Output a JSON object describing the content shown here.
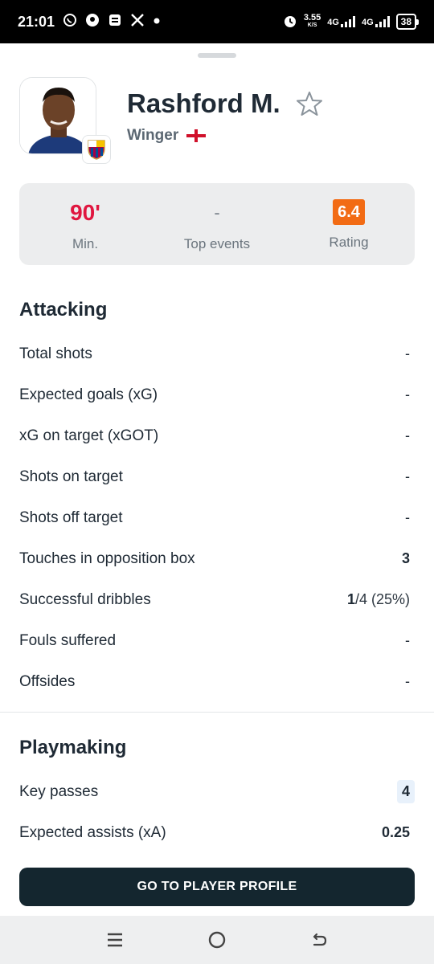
{
  "status_bar": {
    "time": "21:01",
    "speed_value": "3.55",
    "speed_unit": "K/S",
    "network1": "4G",
    "network2": "4G",
    "battery": "38"
  },
  "player": {
    "name": "Rashford M.",
    "position": "Winger"
  },
  "summary": {
    "minutes_value": "90'",
    "minutes_label": "Min.",
    "events_value": "-",
    "events_label": "Top events",
    "rating_value": "6.4",
    "rating_label": "Rating"
  },
  "attacking": {
    "title": "Attacking",
    "rows": [
      {
        "label": "Total shots",
        "value": "-"
      },
      {
        "label": "Expected goals (xG)",
        "value": "-"
      },
      {
        "label": "xG on target (xGOT)",
        "value": "-"
      },
      {
        "label": "Shots on target",
        "value": "-"
      },
      {
        "label": "Shots off target",
        "value": "-"
      },
      {
        "label": "Touches in opposition box",
        "value": "3"
      },
      {
        "label": "Successful dribbles",
        "value_main": "1",
        "value_rest": "/4 (25%)"
      },
      {
        "label": "Fouls suffered",
        "value": "-"
      },
      {
        "label": "Offsides",
        "value": "-"
      }
    ]
  },
  "playmaking": {
    "title": "Playmaking",
    "rows": [
      {
        "label": "Key passes",
        "value": "4"
      },
      {
        "label": "Expected assists (xA)",
        "value": "0.25"
      }
    ]
  },
  "cta": {
    "label": "GO TO PLAYER PROFILE"
  },
  "colors": {
    "accent_red": "#e0163f",
    "rating_orange": "#f26b14",
    "button_dark": "#14262f"
  }
}
